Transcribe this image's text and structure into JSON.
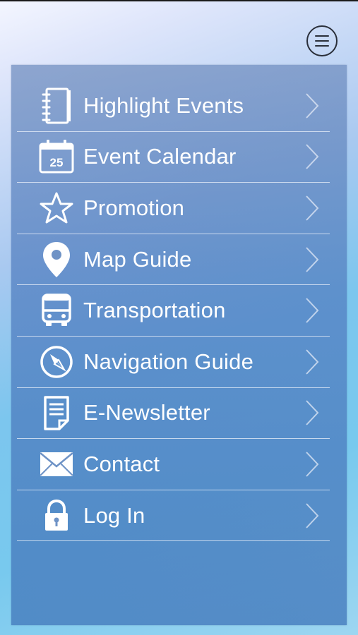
{
  "menu": {
    "items": [
      {
        "label": "Highlight Events",
        "icon": "notebook-icon"
      },
      {
        "label": "Event Calendar",
        "icon": "calendar-icon",
        "calendar_day": "25"
      },
      {
        "label": "Promotion",
        "icon": "star-icon"
      },
      {
        "label": "Map Guide",
        "icon": "map-pin-icon"
      },
      {
        "label": "Transportation",
        "icon": "bus-icon"
      },
      {
        "label": "Navigation Guide",
        "icon": "compass-icon"
      },
      {
        "label": "E-Newsletter",
        "icon": "newsletter-icon"
      },
      {
        "label": "Contact",
        "icon": "envelope-icon"
      },
      {
        "label": "Log In",
        "icon": "lock-icon"
      }
    ]
  },
  "colors": {
    "text": "#ffffff",
    "divider": "#ebf0fa",
    "menu_button": "#2a2f3a"
  }
}
